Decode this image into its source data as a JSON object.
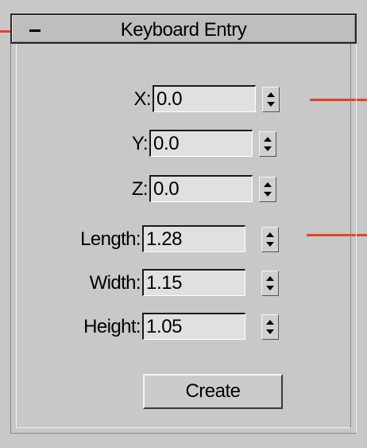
{
  "rollout": {
    "title": "Keyboard Entry",
    "collapse_symbol": "-",
    "collapse_icon": "minus-icon"
  },
  "position_fields": [
    {
      "label": "X:",
      "value": "0.0"
    },
    {
      "label": "Y:",
      "value": "0.0"
    },
    {
      "label": "Z:",
      "value": "0.0"
    }
  ],
  "dimension_fields": [
    {
      "label": "Length:",
      "value": "1.28"
    },
    {
      "label": "Width:",
      "value": "1.15"
    },
    {
      "label": "Height:",
      "value": "1.05"
    }
  ],
  "create_button": {
    "label": "Create"
  },
  "colors": {
    "panel_bg": "#c8c8c8",
    "field_bg": "#e0e0e0",
    "callout": "#e0461e"
  }
}
